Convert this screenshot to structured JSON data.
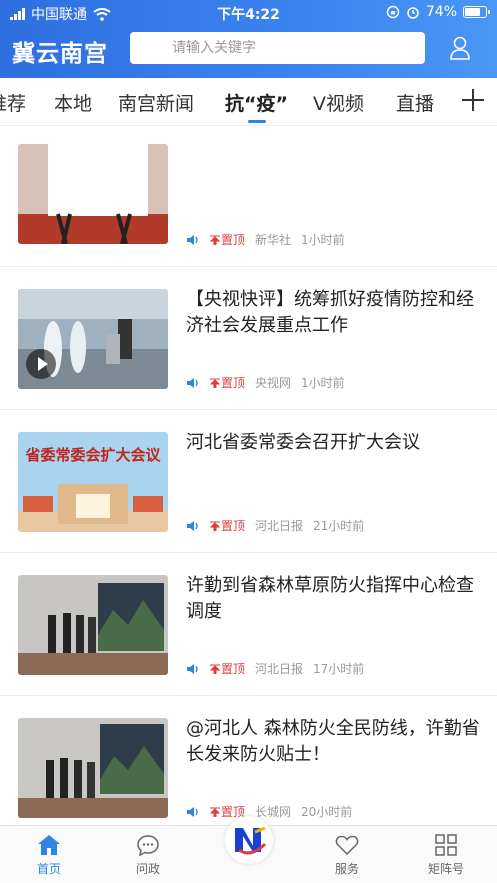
{
  "status_bar": {
    "carrier": "中国联通",
    "time": "下午4:22",
    "battery": "74%"
  },
  "header": {
    "brand": "冀云南宫",
    "search_placeholder": "请输入关键字"
  },
  "tabs": [
    {
      "label": "推荐"
    },
    {
      "label": "本地"
    },
    {
      "label": "南宫新闻"
    },
    {
      "label": "抗“疫”"
    },
    {
      "label": "V视频"
    },
    {
      "label": "直播"
    }
  ],
  "feed": [
    {
      "title": "",
      "pin_label": "置顶",
      "source": "新华社",
      "time": "1小时前"
    },
    {
      "title": "【央视快评】统筹抓好疫情防控和经济社会发展重点工作",
      "pin_label": "置顶",
      "source": "央视网",
      "time": "1小时前"
    },
    {
      "title": "河北省委常委会召开扩大会议",
      "pin_label": "置顶",
      "source": "河北日报",
      "time": "21小时前",
      "thumb_text": "省委常委会扩大会议"
    },
    {
      "title": "许勤到省森林草原防火指挥中心检查调度",
      "pin_label": "置顶",
      "source": "河北日报",
      "time": "17小时前"
    },
    {
      "title": "@河北人 森林防火全民防线，许勤省长发来防火贴士！",
      "pin_label": "置顶",
      "source": "长城网",
      "time": "20小时前"
    }
  ],
  "bottom_nav": [
    {
      "label": "首页",
      "icon": "home-icon"
    },
    {
      "label": "问政",
      "icon": "chat-icon"
    },
    {
      "label": "",
      "icon": "center-logo-icon"
    },
    {
      "label": "服务",
      "icon": "heart-icon"
    },
    {
      "label": "矩阵号",
      "icon": "grid-icon"
    }
  ],
  "colors": {
    "accent": "#2e86de",
    "pin": "#e23b3b",
    "header_start": "#2f6fe0",
    "header_end": "#4a96f5"
  }
}
